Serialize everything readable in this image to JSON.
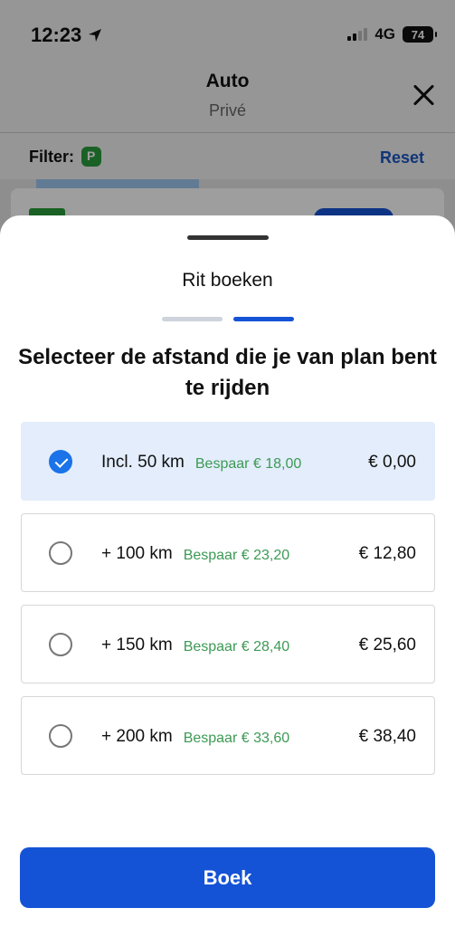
{
  "status_bar": {
    "time": "12:23",
    "network": "4G",
    "battery": "74"
  },
  "background": {
    "title": "Auto",
    "subtitle": "Privé",
    "filter_label": "Filter:",
    "reset_label": "Reset"
  },
  "sheet": {
    "title": "Rit boeken",
    "heading": "Selecteer de afstand die je van plan bent te rijden",
    "steps": [
      {
        "state": "inactive"
      },
      {
        "state": "active"
      }
    ],
    "options": [
      {
        "distance": "Incl. 50 km",
        "saving": "Bespaar € 18,00",
        "price": "€ 0,00",
        "selected": true
      },
      {
        "distance": "+ 100 km",
        "saving": "Bespaar € 23,20",
        "price": "€ 12,80",
        "selected": false
      },
      {
        "distance": "+ 150 km",
        "saving": "Bespaar € 28,40",
        "price": "€ 25,60",
        "selected": false
      },
      {
        "distance": "+ 200 km",
        "saving": "Bespaar € 33,60",
        "price": "€ 38,40",
        "selected": false
      }
    ],
    "book_label": "Boek"
  },
  "colors": {
    "primary": "#1553d6",
    "selected_bg": "#e3edfb",
    "saving_green": "#3c9a55"
  }
}
